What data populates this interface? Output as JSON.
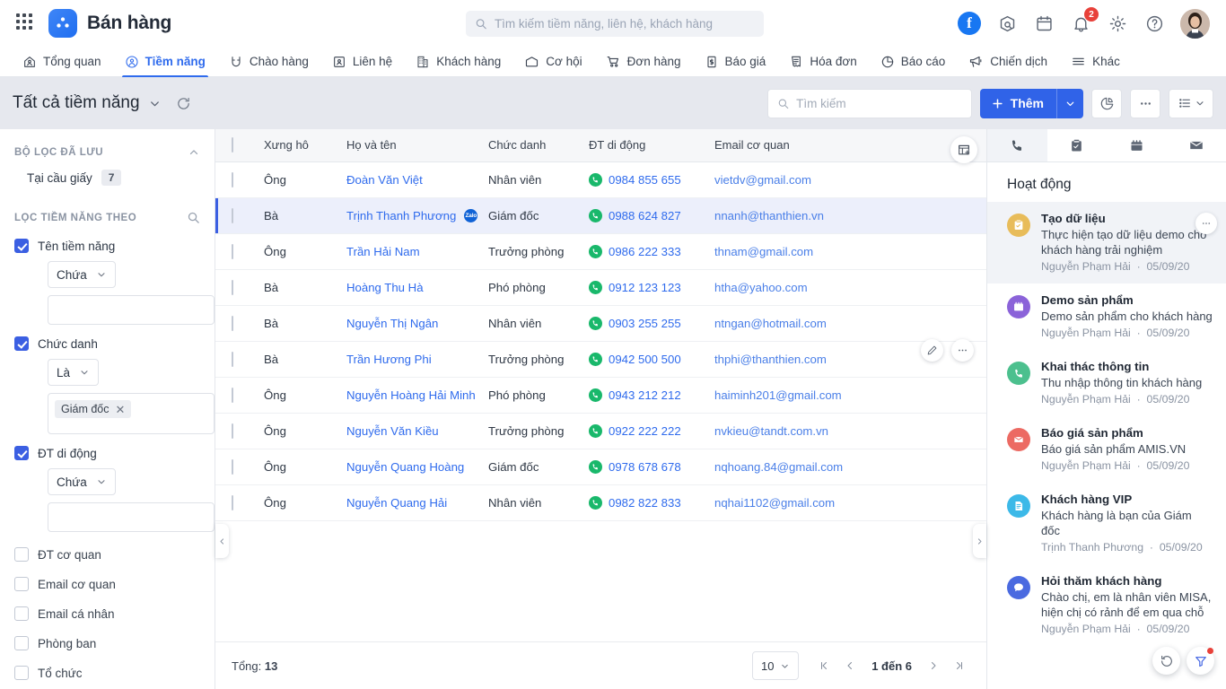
{
  "header": {
    "app_title": "Bán hàng",
    "search_placeholder": "Tìm kiếm tiềm năng, liên hệ, khách hàng",
    "notification_count": "2",
    "icons": [
      "apps-grid-icon",
      "facebook-icon",
      "package-search-icon",
      "calendar-icon",
      "bell-icon",
      "gear-icon",
      "help-icon",
      "avatar"
    ]
  },
  "nav": {
    "tabs": [
      {
        "label": "Tổng quan",
        "icon": "home-person-icon",
        "active": false
      },
      {
        "label": "Tiềm năng",
        "icon": "person-circle-icon",
        "active": true
      },
      {
        "label": "Chào hàng",
        "icon": "magnet-icon",
        "active": false
      },
      {
        "label": "Liên hệ",
        "icon": "contact-card-icon",
        "active": false
      },
      {
        "label": "Khách hàng",
        "icon": "building-icon",
        "active": false
      },
      {
        "label": "Cơ hội",
        "icon": "wallet-icon",
        "active": false
      },
      {
        "label": "Đơn hàng",
        "icon": "cart-icon",
        "active": false
      },
      {
        "label": "Báo giá",
        "icon": "quote-doc-icon",
        "active": false
      },
      {
        "label": "Hóa đơn",
        "icon": "invoice-icon",
        "active": false
      },
      {
        "label": "Báo cáo",
        "icon": "pie-chart-icon",
        "active": false
      },
      {
        "label": "Chiến dịch",
        "icon": "megaphone-icon",
        "active": false
      },
      {
        "label": "Khác",
        "icon": "hamburger-icon",
        "active": false
      }
    ]
  },
  "toolbar": {
    "page_title": "Tất cả tiềm năng",
    "search_placeholder": "Tìm kiếm",
    "search_value": "",
    "add_label": "Thêm",
    "buttons": [
      "chart-button",
      "more-button",
      "list-view-button"
    ]
  },
  "filters": {
    "saved_header": "BỘ LỌC ĐÃ LƯU",
    "saved_items": [
      {
        "label": "Tại cầu giấy",
        "count": "7"
      }
    ],
    "filter_header": "LỌC TIỀM NĂNG THEO",
    "groups": [
      {
        "label": "Tên tiềm năng",
        "checked": true,
        "operator": "Chứa",
        "value": "",
        "type": "text"
      },
      {
        "label": "Chức danh",
        "checked": true,
        "operator": "Là",
        "tags": [
          "Giám đốc"
        ],
        "type": "tags"
      },
      {
        "label": "ĐT di động",
        "checked": true,
        "operator": "Chứa",
        "value": "",
        "type": "text"
      }
    ],
    "plain": [
      {
        "label": "ĐT cơ quan",
        "checked": false
      },
      {
        "label": "Email cơ quan",
        "checked": false
      },
      {
        "label": "Email cá nhân",
        "checked": false
      },
      {
        "label": "Phòng ban",
        "checked": false
      },
      {
        "label": "Tổ chức",
        "checked": false
      }
    ]
  },
  "table": {
    "columns": [
      "Xưng hô",
      "Họ và tên",
      "Chức danh",
      "ĐT di động",
      "Email cơ quan"
    ],
    "rows": [
      {
        "salutation": "Ông",
        "name": "Đoàn Văn Việt",
        "zalo": false,
        "title": "Nhân viên",
        "phone": "0984 855 655",
        "email": "vietdv@gmail.com",
        "selected": false
      },
      {
        "salutation": "Bà",
        "name": "Trịnh Thanh Phương",
        "zalo": true,
        "title": "Giám đốc",
        "phone": "0988 624 827",
        "email": "nnanh@thanthien.vn",
        "selected": true
      },
      {
        "salutation": "Ông",
        "name": "Trần Hải Nam",
        "zalo": false,
        "title": "Trưởng phòng",
        "phone": "0986 222 333",
        "email": "thnam@gmail.com",
        "selected": false
      },
      {
        "salutation": "Bà",
        "name": "Hoàng Thu Hà",
        "zalo": false,
        "title": "Phó phòng",
        "phone": "0912 123 123",
        "email": "htha@yahoo.com",
        "selected": false
      },
      {
        "salutation": "Bà",
        "name": "Nguyễn Thị Ngân",
        "zalo": false,
        "title": "Nhân viên",
        "phone": "0903 255 255",
        "email": "ntngan@hotmail.com",
        "selected": false
      },
      {
        "salutation": "Bà",
        "name": "Trần Hương Phi",
        "zalo": false,
        "title": "Trưởng phòng",
        "phone": "0942 500 500",
        "email": "thphi@thanthien.com",
        "selected": false
      },
      {
        "salutation": "Ông",
        "name": "Nguyễn Hoàng Hải Minh",
        "zalo": false,
        "title": "Phó phòng",
        "phone": "0943 212 212",
        "email": "haiminh201@gmail.com",
        "selected": false
      },
      {
        "salutation": "Ông",
        "name": "Nguyễn Văn Kiều",
        "zalo": false,
        "title": "Trưởng phòng",
        "phone": "0922 222 222",
        "email": "nvkieu@tandt.com.vn",
        "selected": false
      },
      {
        "salutation": "Ông",
        "name": "Nguyễn Quang Hoàng",
        "zalo": false,
        "title": "Giám đốc",
        "phone": "0978 678 678",
        "email": "nqhoang.84@gmail.com",
        "selected": false
      },
      {
        "salutation": "Ông",
        "name": "Nguyễn Quang Hải",
        "zalo": false,
        "title": "Nhân viên",
        "phone": "0982 822 833",
        "email": "nqhai1102@gmail.com",
        "selected": false
      }
    ],
    "zalo_label": "Zalo"
  },
  "footer": {
    "total_label": "Tổng:",
    "total_value": "13",
    "page_size": "10",
    "range_text": "1 đến 6"
  },
  "activity": {
    "tabs": [
      "phone-icon",
      "clipboard-check-icon",
      "calendar-event-icon",
      "envelope-icon"
    ],
    "title": "Hoạt động",
    "items": [
      {
        "title": "Tạo dữ liệu",
        "desc": "Thực hiện tạo dữ liệu demo cho khách hàng trải nghiệm",
        "author": "Nguyễn Phạm Hải",
        "date": "05/09/20",
        "icon": "clipboard-check-icon",
        "color": "#e8bc5a",
        "highlight": true
      },
      {
        "title": "Demo sản phẩm",
        "desc": "Demo sản phẩm cho khách hàng",
        "author": "Nguyễn Phạm Hải",
        "date": "05/09/20",
        "icon": "calendar-event-icon",
        "color": "#8b63d9",
        "highlight": false
      },
      {
        "title": "Khai thác thông tin",
        "desc": "Thu nhập thông tin khách hàng",
        "author": "Nguyễn Phạm Hải",
        "date": "05/09/20",
        "icon": "phone-icon",
        "color": "#4cc08e",
        "highlight": false
      },
      {
        "title": "Báo giá sản phẩm",
        "desc": "Báo giá sản phẩm AMIS.VN",
        "author": "Nguyễn Phạm Hải",
        "date": "05/09/20",
        "icon": "envelope-icon",
        "color": "#ec6a63",
        "highlight": false
      },
      {
        "title": "Khách hàng VIP",
        "desc": "Khách hàng là bạn của Giám đốc",
        "author": "Trịnh Thanh Phương",
        "date": "05/09/20",
        "icon": "note-icon",
        "color": "#3cb9e8",
        "highlight": false
      },
      {
        "title": "Hỏi thăm khách hàng",
        "desc": "Chào chị, em là nhân viên MISA, hiện chị có rảnh để em qua chỗ",
        "author": "Nguyễn Phạm Hải",
        "date": "05/09/20",
        "icon": "chat-icon",
        "color": "#4a6ae0",
        "highlight": false
      }
    ],
    "separator": "·"
  },
  "fabs": [
    "history-icon",
    "filter-icon"
  ],
  "colors": {
    "accent": "#3063e8",
    "link": "#2f6bed",
    "green": "#19b86b",
    "badge": "#e8413a"
  }
}
